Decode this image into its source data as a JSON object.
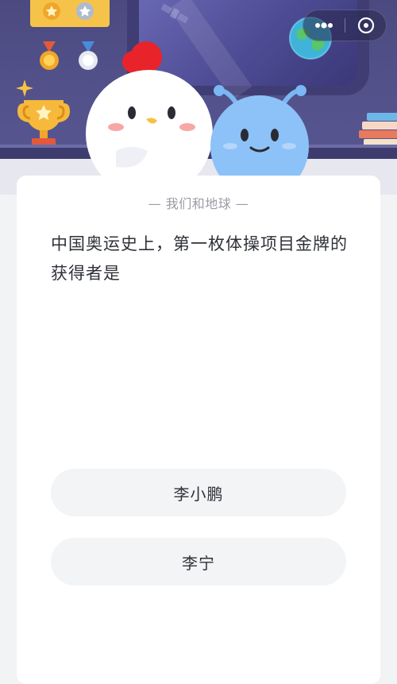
{
  "capsule": {
    "more_icon": "ellipsis-icon",
    "close_icon": "close-circle-icon"
  },
  "quiz": {
    "category": "— 我们和地球 —",
    "question": "中国奥运史上，第一枚体操项目金牌的获得者是",
    "options": [
      {
        "label": "李小鹏"
      },
      {
        "label": "李宁"
      }
    ]
  },
  "colors": {
    "header_bg": "#4b4a80",
    "card_bg": "#ffffff",
    "option_bg": "#f3f4f6",
    "text": "#2e3138",
    "category_text": "#9a9ca3"
  }
}
